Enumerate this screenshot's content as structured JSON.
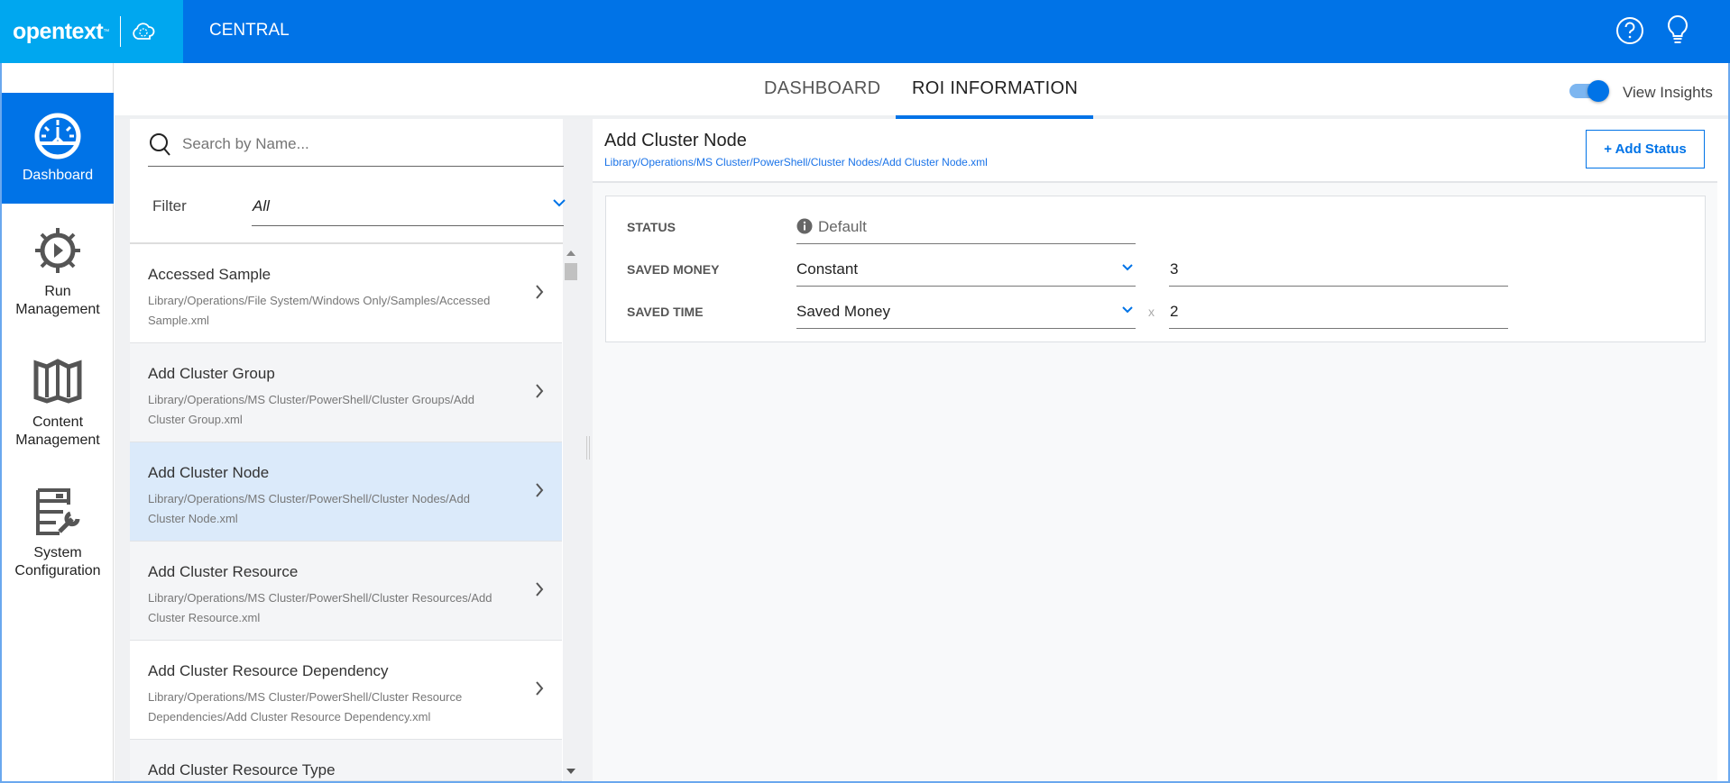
{
  "header": {
    "brand": "opentext",
    "tm": "™",
    "app": "CENTRAL",
    "help_icon": "help-circle-icon",
    "bulb_icon": "lightbulb-icon"
  },
  "sidebar": {
    "items": [
      {
        "label": "Dashboard",
        "active": true
      },
      {
        "label1": "Run",
        "label2": "Management"
      },
      {
        "label1": "Content",
        "label2": "Management"
      },
      {
        "label1": "System",
        "label2": "Configuration"
      }
    ]
  },
  "tabs": [
    {
      "label": "DASHBOARD"
    },
    {
      "label": "ROI INFORMATION",
      "active": true
    }
  ],
  "insights": {
    "label": "View Insights",
    "on": true
  },
  "list": {
    "search_placeholder": "Search by Name...",
    "filter_label": "Filter",
    "filter_value": "All",
    "items": [
      {
        "title": "Accessed Sample",
        "path": "Library/Operations/File System/Windows Only/Samples/Accessed Sample.xml"
      },
      {
        "title": "Add Cluster Group",
        "path": "Library/Operations/MS Cluster/PowerShell/Cluster Groups/Add Cluster Group.xml"
      },
      {
        "title": "Add Cluster Node",
        "path": "Library/Operations/MS Cluster/PowerShell/Cluster Nodes/Add Cluster Node.xml",
        "selected": true
      },
      {
        "title": "Add Cluster Resource",
        "path": "Library/Operations/MS Cluster/PowerShell/Cluster Resources/Add Cluster Resource.xml"
      },
      {
        "title": "Add Cluster Resource Dependency",
        "path": "Library/Operations/MS Cluster/PowerShell/Cluster Resource Dependencies/Add Cluster Resource Dependency.xml"
      },
      {
        "title": "Add Cluster Resource Type",
        "path": ""
      }
    ]
  },
  "detail": {
    "title": "Add Cluster Node",
    "path": "Library/Operations/MS Cluster/PowerShell/Cluster Nodes/Add Cluster Node.xml",
    "add_status": "+ Add Status",
    "status_label": "STATUS",
    "status_value": "Default",
    "saved_money_label": "SAVED MONEY",
    "saved_money_type": "Constant",
    "saved_money_value": "3",
    "saved_time_label": "SAVED TIME",
    "saved_time_type": "Saved Money",
    "multiplier": "x",
    "saved_time_value": "2"
  },
  "colors": {
    "primary": "#0073e7",
    "logo_bg": "#00a7ef",
    "selected_row": "#dbeafa"
  }
}
